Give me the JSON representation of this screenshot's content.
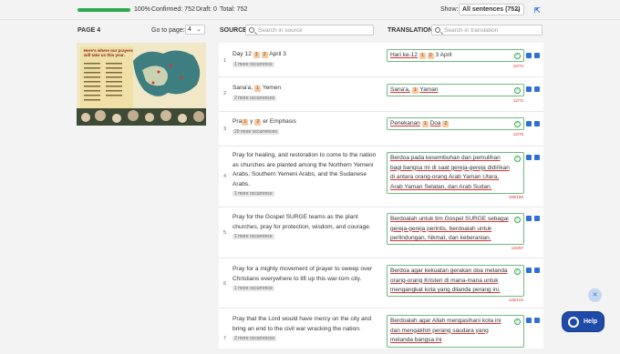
{
  "top": {
    "progress_fraction": 1.0,
    "percent": "100%",
    "confirmed": "Confirmed: 752",
    "draft": "Draft: 0",
    "total": "Total: 752",
    "show_label": "Show:",
    "show_value": "All sentences (752)"
  },
  "left": {
    "page_label": "PAGE 4",
    "goto_label": "Go to page:",
    "goto_value": "4",
    "thumb_title": "Here's where our prayers will take us this year."
  },
  "columns": {
    "source": "SOURCE",
    "source_search": "Search in source",
    "translation": "TRANSLATION",
    "translation_search": "Search in translation"
  },
  "rows": [
    {
      "num": "1",
      "src_a": "Day 12",
      "tag1": "1",
      "tag2": "2",
      "src_b": "April 3",
      "occ": "1 more occurrence",
      "tr_a": "Hari ke-12",
      "tr_b": "3 April",
      "count": "10/74"
    },
    {
      "num": "2",
      "src_a": "Sana'a,",
      "tag1": "1",
      "src_b": "Yemen",
      "occ": "2 more occurrences",
      "tr_a": "Sana'a,",
      "tr_b": "Yaman",
      "count": "12/72"
    },
    {
      "num": "3",
      "src_a": "Pra",
      "tag1": "1",
      "src_mid": "y",
      "tag2": "2",
      "src_b": "er Emphasis",
      "occ": "29 more occurrences",
      "tr_a": "Penekanan",
      "tr_b": "Doa",
      "count": "12/76"
    },
    {
      "num": "4",
      "src": "Pray for healing, and restoration to come to the nation as churches are planted among the Northern Yemeni Arabs, Southern Yemeni Arabs, and the Sudanese Arabs.",
      "occ": "1 more occurrence",
      "tr": "Berdoa pada kesembuhan dan pemulihan bagi bangsa ini di saat gereja-gereja didirikan di antara orang-orang Arab Yaman Utara, Arab Yaman Selatan, dan Arab Sudan.",
      "count": "190/180"
    },
    {
      "num": "5",
      "src": "Pray for the Gospel SURGE teams as the plant churches, pray for protection, wisdom, and courage.",
      "occ": "1 more occurrence",
      "tr": "Berdoalah untuk tim Gospel SURGE sebagai gereja-gereja perintis, berdoalah untuk perlindungan, hikmat, dan keberanian.",
      "count": "115/97"
    },
    {
      "num": "6",
      "src": "Pray for a mighty movement of prayer to sweep over Christians everywhere to lift up this war-torn city.",
      "occ": "1 more occurrence",
      "tr": "Berdoa agar kekuatan gerakan doa melanda orang-orang Kristen di mana-mana untuk mengangkat kota yang dilanda perang ini.",
      "count": "125/104"
    },
    {
      "num": "7",
      "src": "Pray that the Lord would have mercy on the city and bring an end to the civil war wracking the nation.",
      "occ": "2 more occurrences",
      "tr": "Berdoalah agar Allah mengasihani kota ini dan mengakhiri perang saudara yang melanda bangsa ini",
      "count": ""
    }
  ],
  "help_label": "Help",
  "colors": {
    "accent": "#2f6fd6",
    "confirmed": "#2eaa4e",
    "help_bg": "#1e4aa8"
  }
}
